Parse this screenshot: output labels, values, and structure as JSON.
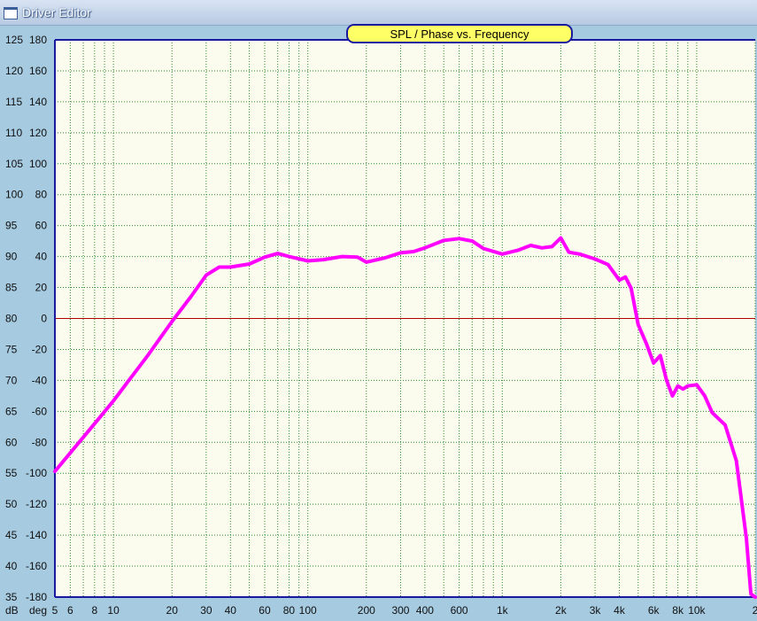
{
  "window": {
    "title": "Driver Editor"
  },
  "colors": {
    "plot_bg": "#fbfbee",
    "grid": "#2a8a2a",
    "zero_line": "#b00000",
    "frame": "#1a1aa0",
    "spl_curve": "#ff00ff",
    "title_badge": "#ffff66"
  },
  "chart_data": {
    "type": "line",
    "title": "SPL / Phase vs. Frequency",
    "x_scale": "log",
    "xlim": [
      5,
      20000
    ],
    "ylabel_left": "dB",
    "ylabel_right": "deg",
    "spl_ticks": [
      "125",
      "120",
      "115",
      "110",
      "105",
      "100",
      "95",
      "90",
      "85",
      "80",
      "75",
      "70",
      "65",
      "60",
      "55",
      "50",
      "45",
      "40",
      "35"
    ],
    "phase_ticks": [
      "180",
      "160",
      "140",
      "120",
      "100",
      "80",
      "60",
      "40",
      "20",
      "0",
      "-20",
      "-40",
      "-60",
      "-80",
      "-100",
      "-120",
      "-140",
      "-160",
      "-180"
    ],
    "ylim_spl": [
      35,
      125
    ],
    "ylim_phase": [
      -180,
      180
    ],
    "x_ticks": [
      {
        "v": 5,
        "label": "5"
      },
      {
        "v": 6,
        "label": "6"
      },
      {
        "v": 8,
        "label": "8"
      },
      {
        "v": 10,
        "label": "10"
      },
      {
        "v": 20,
        "label": "20"
      },
      {
        "v": 30,
        "label": "30"
      },
      {
        "v": 40,
        "label": "40"
      },
      {
        "v": 60,
        "label": "60"
      },
      {
        "v": 80,
        "label": "80"
      },
      {
        "v": 100,
        "label": "100"
      },
      {
        "v": 200,
        "label": "200"
      },
      {
        "v": 300,
        "label": "300"
      },
      {
        "v": 400,
        "label": "400"
      },
      {
        "v": 600,
        "label": "600"
      },
      {
        "v": 1000,
        "label": "1k"
      },
      {
        "v": 2000,
        "label": "2k"
      },
      {
        "v": 3000,
        "label": "3k"
      },
      {
        "v": 4000,
        "label": "4k"
      },
      {
        "v": 6000,
        "label": "6k"
      },
      {
        "v": 8000,
        "label": "8k"
      },
      {
        "v": 10000,
        "label": "10k"
      },
      {
        "v": 20000,
        "label": "2"
      }
    ],
    "grid": true,
    "series": [
      {
        "x": [
          5,
          6,
          8,
          10,
          12,
          15,
          20,
          25,
          30,
          35,
          40,
          50,
          60,
          70,
          80,
          100,
          120,
          150,
          180,
          200,
          250,
          300,
          350,
          400,
          500,
          600,
          700,
          800,
          1000,
          1200,
          1400,
          1600,
          1800,
          2000,
          2200,
          2500,
          3000,
          3500,
          4000,
          4300,
          4600,
          5000,
          5500,
          6000,
          6500,
          7000,
          7500,
          8000,
          8500,
          9000,
          10000,
          11000,
          12000,
          14000,
          16000,
          18000,
          19000,
          20000
        ],
        "y": [
          55.3,
          58.3,
          63.0,
          66.7,
          70.0,
          74.0,
          79.5,
          83.5,
          87.0,
          88.3,
          88.3,
          88.8,
          89.9,
          90.5,
          90.0,
          89.3,
          89.5,
          90.0,
          89.9,
          89.1,
          89.8,
          90.6,
          90.8,
          91.4,
          92.6,
          92.9,
          92.5,
          91.3,
          90.4,
          91.0,
          91.8,
          91.4,
          91.6,
          93.0,
          90.7,
          90.4,
          89.6,
          88.7,
          86.2,
          86.7,
          84.9,
          79.0,
          76.0,
          72.8,
          74.0,
          70.0,
          67.5,
          69.1,
          68.6,
          69.1,
          69.3,
          67.5,
          64.8,
          62.8,
          57.0,
          44.5,
          35.5,
          35.0
        ]
      }
    ]
  }
}
